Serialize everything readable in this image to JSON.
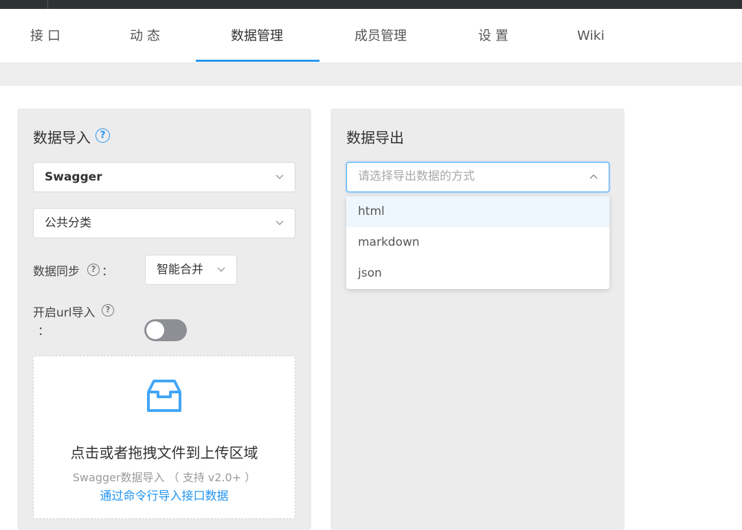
{
  "tabs": [
    {
      "label": "接 口"
    },
    {
      "label": "动 态"
    },
    {
      "label": "数据管理"
    },
    {
      "label": "成员管理"
    },
    {
      "label": "设 置"
    },
    {
      "label": "Wiki"
    }
  ],
  "active_tab": "数据管理",
  "import_panel": {
    "title": "数据导入",
    "help": "?",
    "format_select": {
      "value": "Swagger"
    },
    "category_select": {
      "value": "公共分类"
    },
    "sync_label": "数据同步",
    "sync_colon": "：",
    "sync_select": {
      "value": "智能合并"
    },
    "url_import_label": "开启url导入",
    "url_import_colon": "：",
    "url_import_enabled": false,
    "dropzone": {
      "main_text": "点击或者拖拽文件到上传区域",
      "sub_text": "Swagger数据导入 （ 支持 v2.0+ ）",
      "link_text": "通过命令行导入接口数据"
    }
  },
  "export_panel": {
    "title": "数据导出",
    "select": {
      "placeholder": "请选择导出数据的方式"
    },
    "options": [
      {
        "label": "html"
      },
      {
        "label": "markdown"
      },
      {
        "label": "json"
      }
    ],
    "highlighted_option": "html"
  },
  "colors": {
    "accent": "#2395f1",
    "topbar": "#2f3235",
    "panel_bg": "#ececed",
    "toggle_off": "#8d8f94"
  }
}
